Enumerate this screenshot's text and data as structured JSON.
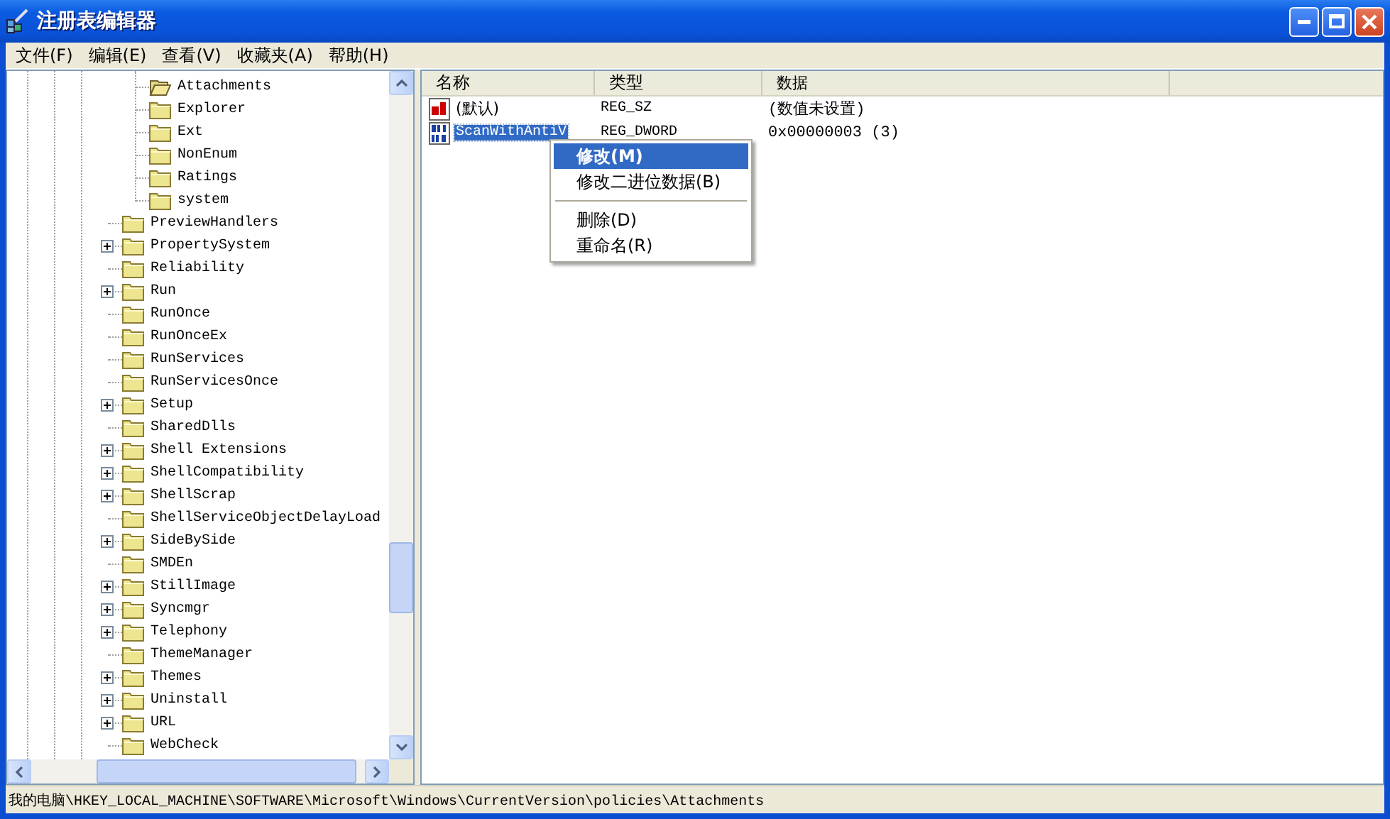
{
  "window": {
    "title": "注册表编辑器"
  },
  "menu_bar": [
    "文件(F)",
    "编辑(E)",
    "查看(V)",
    "收藏夹(A)",
    "帮助(H)"
  ],
  "tree": {
    "items": [
      {
        "children": [
          {
            "label": "Attachments",
            "expandable": false,
            "selected": true
          },
          {
            "label": "Explorer",
            "expandable": false,
            "selected": false
          },
          {
            "label": "Ext",
            "expandable": false,
            "selected": false
          },
          {
            "label": "NonEnum",
            "expandable": false,
            "selected": false
          },
          {
            "label": "Ratings",
            "expandable": false,
            "selected": false
          },
          {
            "label": "system",
            "expandable": false,
            "selected": false
          }
        ]
      },
      {
        "label": "PreviewHandlers",
        "expandable": false,
        "selected": false
      },
      {
        "label": "PropertySystem",
        "expandable": true,
        "selected": false
      },
      {
        "label": "Reliability",
        "expandable": false,
        "selected": false
      },
      {
        "label": "Run",
        "expandable": true,
        "selected": false
      },
      {
        "label": "RunOnce",
        "expandable": false,
        "selected": false
      },
      {
        "label": "RunOnceEx",
        "expandable": false,
        "selected": false
      },
      {
        "label": "RunServices",
        "expandable": false,
        "selected": false
      },
      {
        "label": "RunServicesOnce",
        "expandable": false,
        "selected": false
      },
      {
        "label": "Setup",
        "expandable": true,
        "selected": false
      },
      {
        "label": "SharedDlls",
        "expandable": false,
        "selected": false
      },
      {
        "label": "Shell Extensions",
        "expandable": true,
        "selected": false
      },
      {
        "label": "ShellCompatibility",
        "expandable": true,
        "selected": false
      },
      {
        "label": "ShellScrap",
        "expandable": true,
        "selected": false
      },
      {
        "label": "ShellServiceObjectDelayLoad",
        "expandable": false,
        "selected": false
      },
      {
        "label": "SideBySide",
        "expandable": true,
        "selected": false
      },
      {
        "label": "SMDEn",
        "expandable": false,
        "selected": false
      },
      {
        "label": "StillImage",
        "expandable": true,
        "selected": false
      },
      {
        "label": "Syncmgr",
        "expandable": true,
        "selected": false
      },
      {
        "label": "Telephony",
        "expandable": true,
        "selected": false
      },
      {
        "label": "ThemeManager",
        "expandable": false,
        "selected": false
      },
      {
        "label": "Themes",
        "expandable": true,
        "selected": false
      },
      {
        "label": "Uninstall",
        "expandable": true,
        "selected": false
      },
      {
        "label": "URL",
        "expandable": true,
        "selected": false
      },
      {
        "label": "WebCheck",
        "expandable": false,
        "selected": false
      }
    ]
  },
  "table": {
    "columns": [
      "名称",
      "类型",
      "数据"
    ],
    "rows": [
      {
        "kind": "string",
        "name": "(默认)",
        "type": "REG_SZ",
        "data": "(数值未设置)",
        "selected": false
      },
      {
        "kind": "binary",
        "name": "ScanWithAntiV",
        "type": "REG_DWORD",
        "data": "0x00000003 (3)",
        "selected": true
      }
    ]
  },
  "context_menu": {
    "items": [
      {
        "kind": "item",
        "label": "修改(M)",
        "selected": true,
        "default": true
      },
      {
        "kind": "item",
        "label": "修改二进位数据(B)",
        "selected": false,
        "default": false
      },
      {
        "kind": "separator"
      },
      {
        "kind": "item",
        "label": "删除(D)",
        "selected": false,
        "default": false
      },
      {
        "kind": "item",
        "label": "重命名(R)",
        "selected": false,
        "default": false
      }
    ]
  },
  "status_bar": "我的电脑\\HKEY_LOCAL_MACHINE\\SOFTWARE\\Microsoft\\Windows\\CurrentVersion\\policies\\Attachments"
}
